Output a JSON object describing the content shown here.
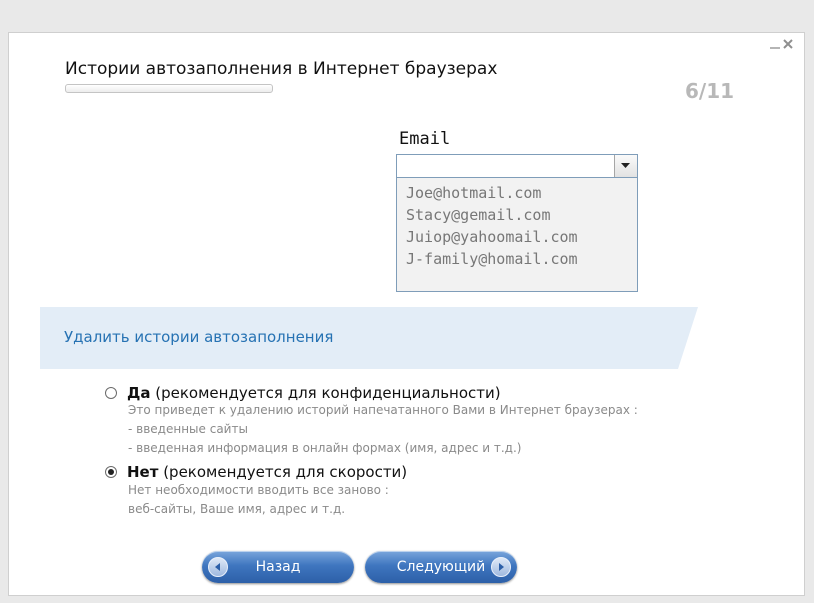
{
  "window": {
    "title": "Истории автозаполнения в Интернет браузерах",
    "step": "6/11",
    "progress": 0.0
  },
  "email_preview": {
    "label": "Email",
    "selected_value": "",
    "options": [
      "Joe@hotmail.com",
      "Stacy@gemail.com",
      "Juiop@yahoomail.com",
      "J-family@homail.com"
    ]
  },
  "section": {
    "title": "Удалить истории автозаполнения"
  },
  "options": [
    {
      "label_bold": "Да",
      "label_rest": " (рекомендуется для конфиденциальности)",
      "selected": false,
      "description": [
        "Это приведет к удалению историй напечатанного Вами в Интернет браузерах :",
        "- введенные сайты",
        "- введенная информация в онлайн формах (имя, адрес и т.д.)"
      ]
    },
    {
      "label_bold": "Нет",
      "label_rest": " (рекомендуется для скорости)",
      "selected": true,
      "description": [
        "Нет необходимости вводить все заново :",
        "веб-сайты, Ваше имя, адрес и т.д."
      ]
    }
  ],
  "buttons": {
    "back": "Назад",
    "next": "Следующий"
  },
  "icons": {
    "minimize": "minimize-icon",
    "close": "close-icon",
    "dropdown": "chevron-down-icon",
    "back": "arrow-left-icon",
    "next": "arrow-right-icon"
  },
  "colors": {
    "accent": "#2672b3",
    "banner": "#e3edf7",
    "button": "#3f76bf"
  }
}
